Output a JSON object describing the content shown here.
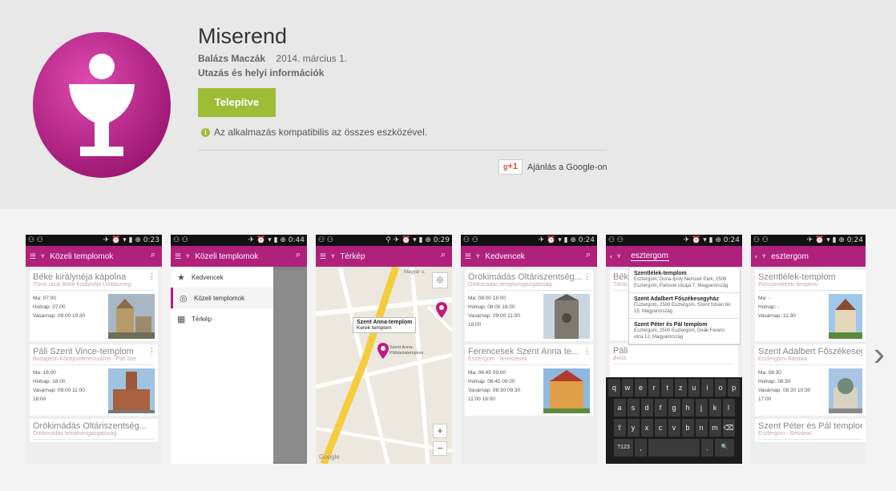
{
  "app": {
    "title": "Miserend",
    "author": "Balázs Maczák",
    "date": "2014. március 1.",
    "category": "Utazás és helyi információk",
    "install_label": "Telepítve",
    "compat_text": "Az alkalmazás kompatibilis az összes eszközével.",
    "gplus_label": "+1",
    "recommend_text": "Ajánlás a Google-on",
    "accent_color": "#b0217c",
    "install_color": "#9ebc35"
  },
  "screens": [
    {
      "status_time": "0:23",
      "appbar_title": "Közeli templomok",
      "cards": [
        {
          "title": "Béke királynéja kápolna",
          "sub": "Tömő utcai Béke Királynője Lelkészség",
          "lines": [
            "Ma: 07:00",
            "Holnap: 07:00",
            "Vasárnap: 09:00 10:30"
          ]
        },
        {
          "title": "Páli Szent Vince-templom",
          "sub": "Budapest–Középsőferencváros - Páli Sze",
          "lines": [
            "Ma: 18:00",
            "Holnap: 18:00",
            "Vasárnap: 09:00 11:00",
            "18:00"
          ]
        },
        {
          "title": "Örökimádás Oltáriszentség...",
          "sub": "Örökimádás templomigazgatóság",
          "lines": []
        }
      ]
    },
    {
      "status_time": "0:44",
      "appbar_title": "Közeli templomok",
      "drawer": [
        "Kedvencek",
        "Közeli templomok",
        "Térkép"
      ]
    },
    {
      "status_time": "0:29",
      "appbar_title": "Térkép",
      "bubble_title": "Szent Anna-templom",
      "bubble_sub": "Kerek templom",
      "map_labels": [
        "Magyar u.",
        "Szent Anna-Plébániatemplom",
        "Google"
      ]
    },
    {
      "status_time": "0:24",
      "appbar_title": "Kedvencek",
      "cards": [
        {
          "title": "Örökimádás Oltáriszentség...",
          "sub": "Örökimádás templomigazgatóság",
          "lines": [
            "Ma: 08:00 18:00",
            "Holnap: 08:00 18:00",
            "Vasárnap: 09:00 11:00",
            "18:00"
          ]
        },
        {
          "title": "Ferencesek Szent Anna te...",
          "sub": "Esztergom - ferencesek",
          "lines": [
            "Ma: 06:45 09:00",
            "Holnap: 06:45 09:00",
            "Vasárnap: 08:30 09:30",
            "11:00 16:00"
          ]
        }
      ]
    },
    {
      "status_time": "0:24",
      "search_value": "esztergom",
      "suggestions": [
        {
          "name": "Szentlélek-templom",
          "addr": "Esztergom, Duna-Ipoly Nemzeti Park, 2508 Esztergom, Palosok utcája 7, Magyarország"
        },
        {
          "name": "Szent Adalbert Főszékesegyház",
          "addr": "Esztergom, 2500 Esztergom, Szent István tér 15, Magyarország"
        },
        {
          "name": "Szent Péter és Pál templom",
          "addr": "Esztergom, 2500 Esztergom, Deák Ferenc utca 12, Magyarország"
        }
      ],
      "bg_cards": [
        "Béke",
        "Tömő",
        "Páli",
        "Buda"
      ],
      "keys": [
        [
          "q",
          "w",
          "e",
          "r",
          "t",
          "z",
          "u",
          "i",
          "o",
          "p"
        ],
        [
          "a",
          "s",
          "d",
          "f",
          "g",
          "h",
          "j",
          "k",
          "l"
        ],
        [
          "⇧",
          "y",
          "x",
          "c",
          "v",
          "b",
          "n",
          "m",
          "⌫"
        ],
        [
          "?123",
          ",",
          "",
          ".",
          " 🔍"
        ]
      ]
    },
    {
      "status_time": "0:24",
      "appbar_title": "esztergom",
      "cards": [
        {
          "title": "Szentlélek-templom",
          "sub": "Pilisszentléleki templom",
          "lines": [
            "Ma: -",
            "Holnap: -",
            "Vasárnap: 11:30"
          ]
        },
        {
          "title": "Szent Adalbert Főszékesegyház",
          "sub": "Esztergomi Bazilika",
          "lines": [
            "Ma: 08:30",
            "Holnap: 08:30",
            "Vasárnap: 08:30 10:30",
            "17:00"
          ]
        },
        {
          "title": "Szent Péter és Pál templom",
          "sub": "Esztergom - Belváros",
          "lines": []
        }
      ]
    }
  ]
}
